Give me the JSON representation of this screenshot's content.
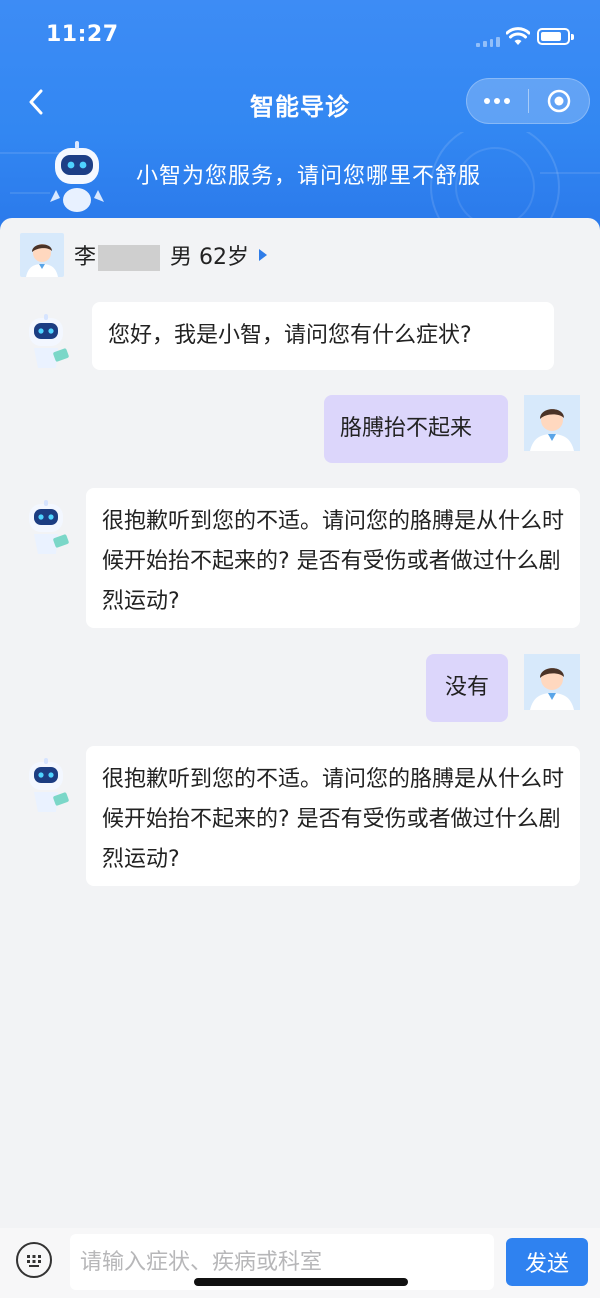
{
  "status_bar": {
    "time": "11:27"
  },
  "nav": {
    "title": "智能导诊"
  },
  "banner": {
    "text": "小智为您服务，请问您哪里不舒服"
  },
  "patient": {
    "surname": "李",
    "gender_age": "男 62岁"
  },
  "messages": [
    {
      "role": "bot",
      "text": "您好，我是小智，请问您有什么症状?"
    },
    {
      "role": "user",
      "text": "胳膊抬不起来"
    },
    {
      "role": "bot",
      "text": "很抱歉听到您的不适。请问您的胳膊是从什么时候开始抬不起来的? 是否有受伤或者做过什么剧烈运动?"
    },
    {
      "role": "user",
      "text": "没有"
    },
    {
      "role": "bot",
      "text": "很抱歉听到您的不适。请问您的胳膊是从什么时候开始抬不起来的? 是否有受伤或者做过什么剧烈运动?"
    }
  ],
  "input": {
    "placeholder": "请输入症状、疾病或科室",
    "value": ""
  },
  "send_label": "发送",
  "colors": {
    "primary_blue": "#3287f2",
    "user_bubble": "#dcd6fb",
    "send_button": "#2f82f0"
  }
}
